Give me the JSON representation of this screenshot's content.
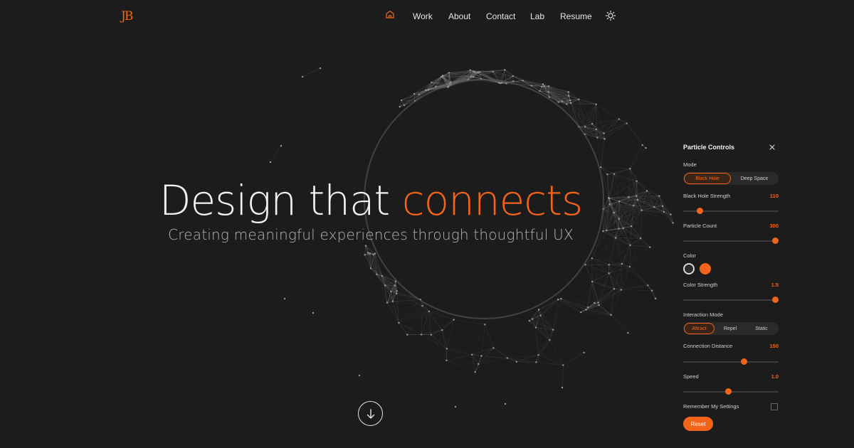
{
  "logo": "JB",
  "nav": {
    "home_icon": "home-icon",
    "items": [
      {
        "label": "Work"
      },
      {
        "label": "About"
      },
      {
        "label": "Contact"
      },
      {
        "label": "Lab"
      },
      {
        "label": "Resume"
      }
    ],
    "theme_icon": "sun-icon"
  },
  "hero": {
    "title_main": "Design that",
    "title_accent": "connects",
    "subtitle": "Creating meaningful experiences through thoughtful UX",
    "scroll_icon": "arrow-down-icon"
  },
  "panel": {
    "title": "Particle Controls",
    "close_icon": "close-icon",
    "mode_label": "Mode",
    "modes": [
      "Black Hole",
      "Deep Space"
    ],
    "active_mode": "Black Hole",
    "bh_strength": {
      "label": "Black Hole Strength",
      "value": "110",
      "level": 0.15
    },
    "particle_count": {
      "label": "Particle Count",
      "value": "300",
      "level": 1.0
    },
    "color_label": "Color",
    "colors": [
      "#2b2b2b",
      "#f26419"
    ],
    "selected_color": "#2b2b2b",
    "color_strength": {
      "label": "Color Strength",
      "value": "1.5",
      "level": 1.0
    },
    "interaction_label": "Interaction Mode",
    "interactions": [
      "Attract",
      "Repel",
      "Static"
    ],
    "active_interaction": "Attract",
    "connection_distance": {
      "label": "Connection Distance",
      "value": "150",
      "level": 0.65
    },
    "speed": {
      "label": "Speed",
      "value": "1.0",
      "level": 0.47
    },
    "remember_label": "Remember My Settings",
    "remember_checked": false,
    "reset_label": "Reset"
  },
  "colors": {
    "accent": "#f26419",
    "background": "#1c1c1c"
  }
}
